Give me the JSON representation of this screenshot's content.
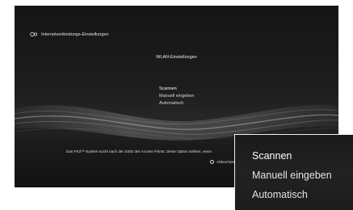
{
  "header": {
    "title": "Internetverbindungs-Einstellungen",
    "icon": "globe-network-icon"
  },
  "dialog": {
    "title": "WLAN-Einstellungen"
  },
  "menu": {
    "items": [
      {
        "label": "Scannen",
        "selected": true
      },
      {
        "label": "Manuell eingeben",
        "selected": false
      },
      {
        "label": "Automatisch",
        "selected": false
      }
    ]
  },
  "footer": {
    "description": "Das PS3™-System sucht nach der SSID des Access Points. Diese Option wählen, wenn",
    "cancel_label": "Abbrechen",
    "cancel_icon": "circle-button-icon"
  },
  "zoom": {
    "items": [
      {
        "label": "Scannen",
        "selected": true
      },
      {
        "label": "Manuell eingeben",
        "selected": false
      },
      {
        "label": "Automatisch",
        "selected": false
      }
    ]
  },
  "colors": {
    "background": "#1b1b1b",
    "text": "#e6e6e6",
    "wave": "#ffffff"
  }
}
